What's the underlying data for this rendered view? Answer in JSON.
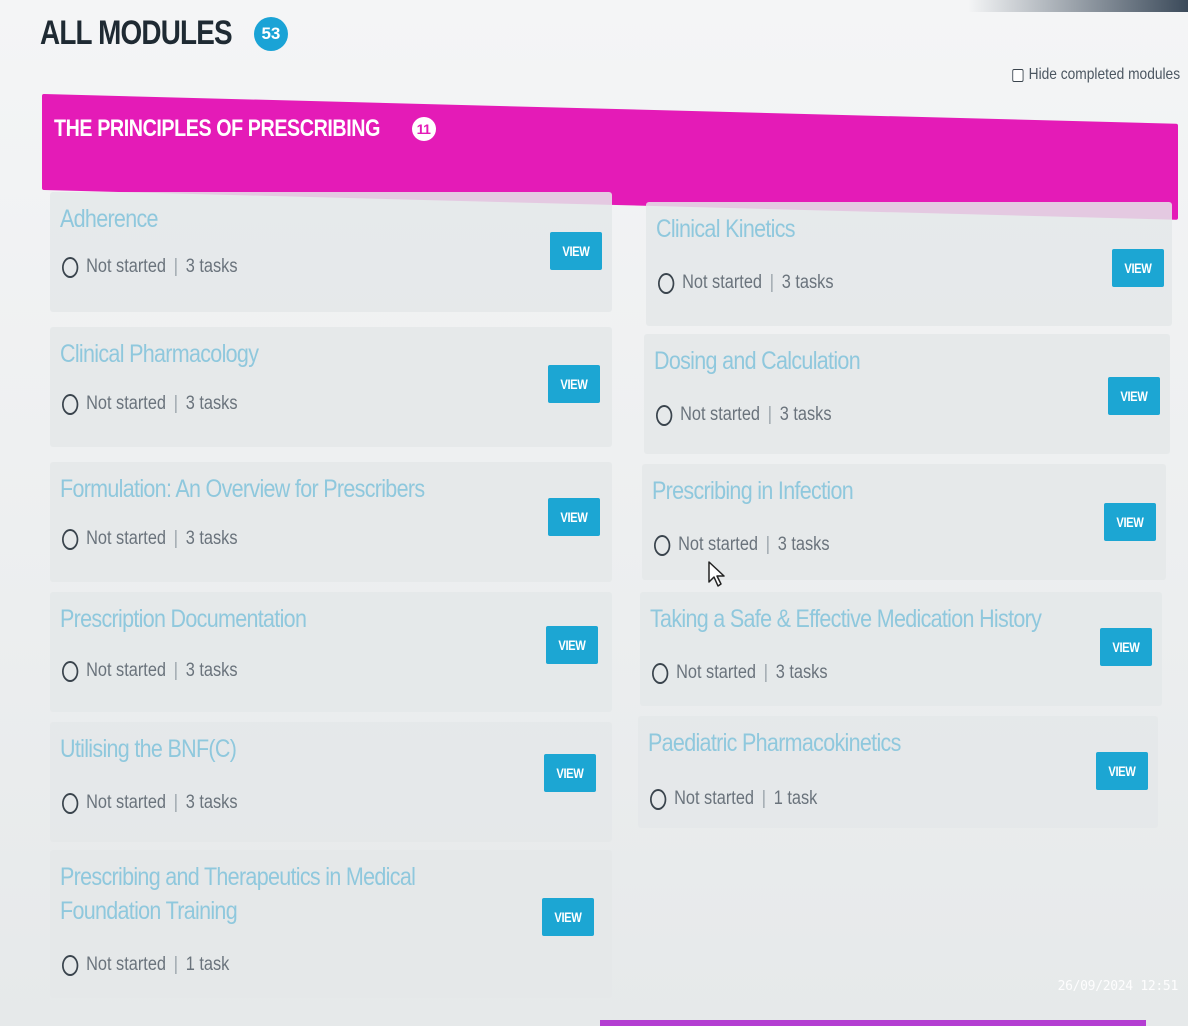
{
  "page": {
    "title": "ALL MODULES",
    "count": "53",
    "hide_completed_label": "Hide completed modules"
  },
  "section": {
    "title": "THE PRINCIPLES OF PRESCRIBING",
    "count": "11"
  },
  "modules": [
    {
      "title": "Adherence",
      "status": "Not started",
      "tasks": "3 tasks",
      "button": "VIEW"
    },
    {
      "title": "Clinical Kinetics",
      "status": "Not started",
      "tasks": "3 tasks",
      "button": "VIEW"
    },
    {
      "title": "Clinical Pharmacology",
      "status": "Not started",
      "tasks": "3 tasks",
      "button": "VIEW"
    },
    {
      "title": "Dosing and Calculation",
      "status": "Not started",
      "tasks": "3 tasks",
      "button": "VIEW"
    },
    {
      "title": "Formulation: An Overview for Prescribers",
      "status": "Not started",
      "tasks": "3 tasks",
      "button": "VIEW"
    },
    {
      "title": "Prescribing in Infection",
      "status": "Not started",
      "tasks": "3 tasks",
      "button": "VIEW"
    },
    {
      "title": "Prescription Documentation",
      "status": "Not started",
      "tasks": "3 tasks",
      "button": "VIEW"
    },
    {
      "title": "Taking a Safe & Effective Medication History",
      "status": "Not started",
      "tasks": "3 tasks",
      "button": "VIEW"
    },
    {
      "title": "Utilising the BNF(C)",
      "status": "Not started",
      "tasks": "3 tasks",
      "button": "VIEW"
    },
    {
      "title": "Paediatric Pharmacokinetics",
      "status": "Not started",
      "tasks": "1 task",
      "button": "VIEW"
    },
    {
      "title": "Prescribing and Therapeutics in Medical Foundation Training",
      "status": "Not started",
      "tasks": "1 task",
      "button": "VIEW"
    }
  ],
  "overlay": {
    "timestamp": "26/09/2024 12:51"
  },
  "colors": {
    "section_bar": "#e41bb7",
    "accent_blue": "#1ca6d3",
    "title_blue": "#8fc8dd"
  },
  "icons": {
    "status": "empty-circle-icon",
    "checkbox": "checkbox-icon",
    "cursor": "mouse-pointer-icon"
  }
}
